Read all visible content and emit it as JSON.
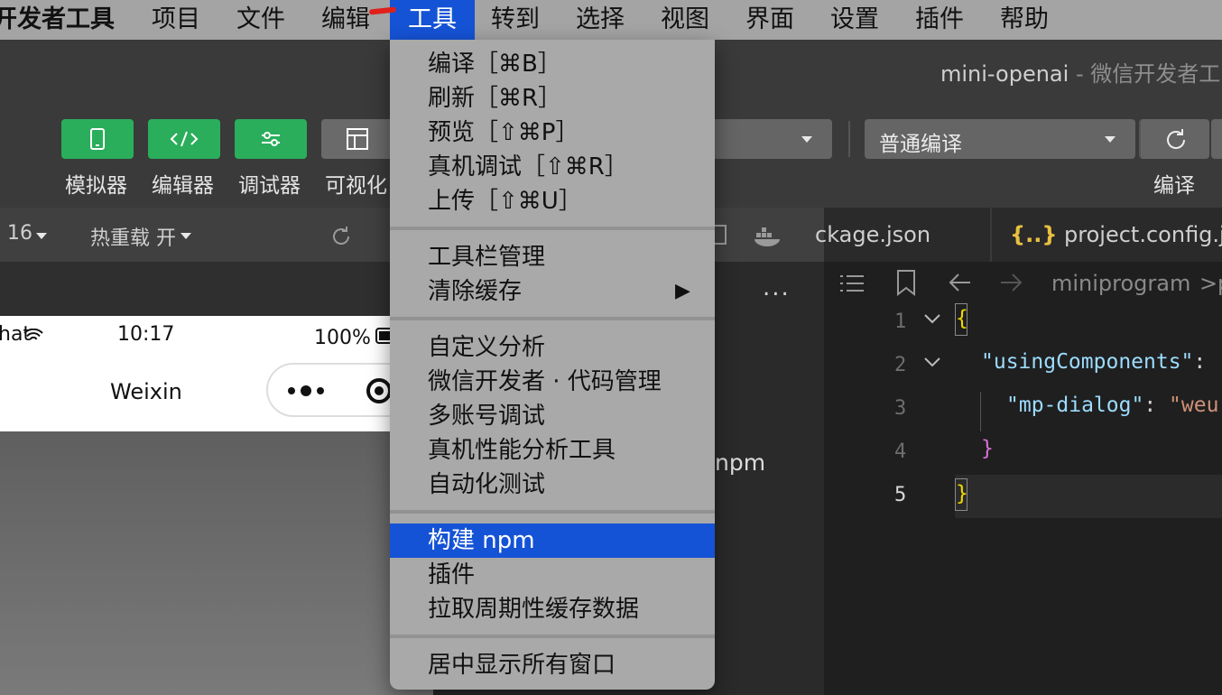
{
  "menubar": {
    "app_name": "开发者工具",
    "items": [
      "项目",
      "文件",
      "编辑",
      "工具",
      "转到",
      "选择",
      "视图",
      "界面",
      "设置",
      "插件",
      "帮助"
    ],
    "active_item": "工具"
  },
  "window": {
    "title": "mini-openai",
    "title_suffix": " - 微信开发者工"
  },
  "toolbar": {
    "buttons": [
      {
        "label": "模拟器",
        "icon": "phone-icon"
      },
      {
        "label": "编辑器",
        "icon": "code-icon"
      },
      {
        "label": "调试器",
        "icon": "sliders-icon"
      },
      {
        "label": "可视化",
        "icon": "layout-icon"
      }
    ],
    "compile_mode": "普通编译",
    "compile_label": "编译"
  },
  "subbar": {
    "zoom_fragment": "16",
    "hot_reload": "热重载 开"
  },
  "phone": {
    "carrier_fragment": "hat",
    "time": "10:17",
    "battery": "100%",
    "nav_title": "Weixin"
  },
  "explorer": {
    "more": "...",
    "row_fragment": "npm"
  },
  "editor": {
    "tabs": [
      {
        "label": "ckage.json"
      },
      {
        "icon": "{..}",
        "label": "project.config.js"
      }
    ],
    "breadcrumb": [
      "miniprogram",
      ">",
      "p"
    ],
    "line_numbers": [
      "1",
      "2",
      "3",
      "4",
      "5"
    ],
    "lines": [
      {
        "n": "1",
        "text": "{"
      },
      {
        "n": "2",
        "key": "\"usingComponents\"",
        "punct": ":"
      },
      {
        "n": "3",
        "key": "\"mp-dialog\"",
        "punct": ":",
        "value": "\"weu"
      },
      {
        "n": "4",
        "text": "}"
      },
      {
        "n": "5",
        "text": "}"
      }
    ],
    "colors": {
      "key": "#9cdcfe",
      "string": "#ce9178",
      "brace1": "#f1d700",
      "brace2": "#da70d6"
    }
  },
  "tools_menu": {
    "groups": [
      [
        "编译［⌘B］",
        "刷新［⌘R］",
        "预览［⇧⌘P］",
        "真机调试［⇧⌘R］",
        "上传［⇧⌘U］"
      ],
      [
        "工具栏管理",
        "清除缓存"
      ],
      [
        "自定义分析",
        "微信开发者 · 代码管理",
        "多账号调试",
        "真机性能分析工具",
        "自动化测试"
      ],
      [
        "构建 npm",
        "插件",
        "拉取周期性缓存数据"
      ],
      [
        "居中显示所有窗口"
      ]
    ],
    "submenu_arrow": "▶",
    "highlighted": "构建 npm"
  },
  "colors": {
    "menu_highlight": "#1553d6",
    "green_button": "#2aae5b",
    "menubar_bg": "#a4a4a4"
  }
}
